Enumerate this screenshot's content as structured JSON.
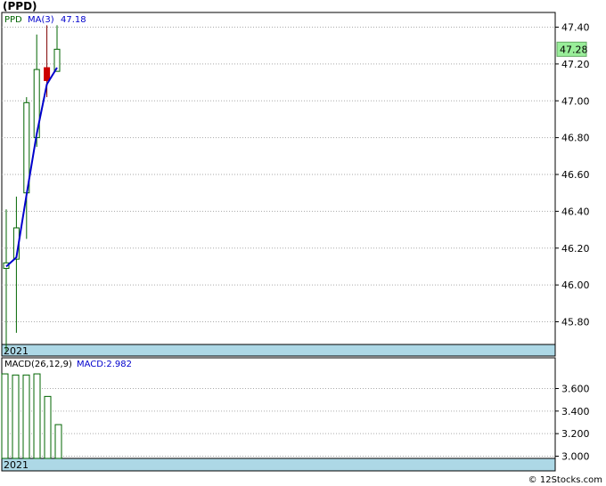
{
  "title": "(PPD)",
  "footer": "© 12Stocks.com",
  "colors": {
    "up_candle": "#006400",
    "down_candle": "#cc0000",
    "ma_line": "#0000cc",
    "macd_bar": "#006400",
    "year_band": "#add8e6",
    "price_box": "#99ee99",
    "grid": "#aaaaaa"
  },
  "chart_data": [
    {
      "type": "candlestick",
      "legend": {
        "symbol": "PPD",
        "ma_label": "MA(3)",
        "ma_value": "47.18"
      },
      "x_label": "2021",
      "ylim": [
        45.64,
        47.48
      ],
      "yticks": [
        "47.40",
        "47.20",
        "47.00",
        "46.80",
        "46.60",
        "46.40",
        "46.20",
        "46.00",
        "45.80"
      ],
      "last_price": "47.28",
      "candles": [
        {
          "open": 46.09,
          "close": 46.12,
          "high": 46.41,
          "low": 45.64,
          "dir": "up"
        },
        {
          "open": 46.14,
          "close": 46.31,
          "high": 46.48,
          "low": 45.74,
          "dir": "up"
        },
        {
          "open": 46.5,
          "close": 46.99,
          "high": 47.02,
          "low": 46.25,
          "dir": "up"
        },
        {
          "open": 46.8,
          "close": 47.17,
          "high": 47.36,
          "low": 46.75,
          "dir": "up"
        },
        {
          "open": 47.18,
          "close": 47.11,
          "high": 47.41,
          "low": 47.02,
          "dir": "down"
        },
        {
          "open": 47.16,
          "close": 47.28,
          "high": 47.41,
          "low": 47.16,
          "dir": "up"
        }
      ],
      "ma": [
        46.1,
        46.15,
        46.49,
        46.82,
        47.09,
        47.18
      ]
    },
    {
      "type": "bar",
      "legend": {
        "label": "MACD(26,12,9)",
        "value_label": "MACD:2.982"
      },
      "x_label": "2021",
      "ylim": [
        2.982,
        3.66
      ],
      "yticks": [
        "3.600",
        "3.400",
        "3.200",
        "3.000"
      ],
      "values": [
        3.73,
        3.72,
        3.72,
        3.73,
        3.53,
        3.28
      ]
    }
  ]
}
